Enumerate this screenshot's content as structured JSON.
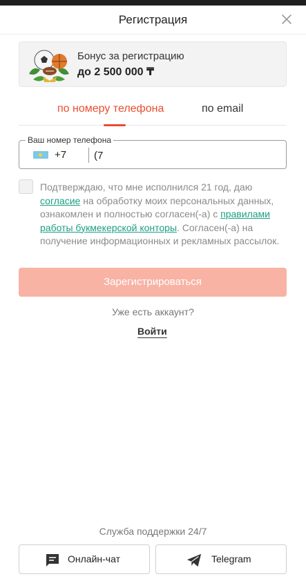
{
  "header": {
    "title": "Регистрация"
  },
  "bonus": {
    "line1": "Бонус за регистрацию",
    "line2": "до 2 500 000 ₸"
  },
  "tabs": [
    {
      "label": "по номеру телефона",
      "active": true
    },
    {
      "label": "по email",
      "active": false
    }
  ],
  "phone": {
    "legend": "Ваш номер телефона",
    "country_code": "+7",
    "value": "(7"
  },
  "consent": {
    "part1": "Подтверждаю, что мне исполнился 21 год, даю ",
    "link1": "согласие",
    "part2": " на обработку моих персональных данных, ознакомлен и полностью согласен(-а) с ",
    "link2": "правилами работы букмекерской конторы",
    "part3": ". Согласен(-а) на получение информационных и рекламных рассылок.",
    "checked": false
  },
  "register_button": "Зарегистрироваться",
  "have_account": "Уже есть аккаунт?",
  "login": "Войти",
  "support": {
    "title": "Служба поддержки 24/7",
    "chat_label": "Онлайн-чат",
    "telegram_label": "Telegram"
  },
  "colors": {
    "accent": "#e84d2f",
    "button_disabled": "#f8b3a5",
    "link": "#1a9f82"
  }
}
